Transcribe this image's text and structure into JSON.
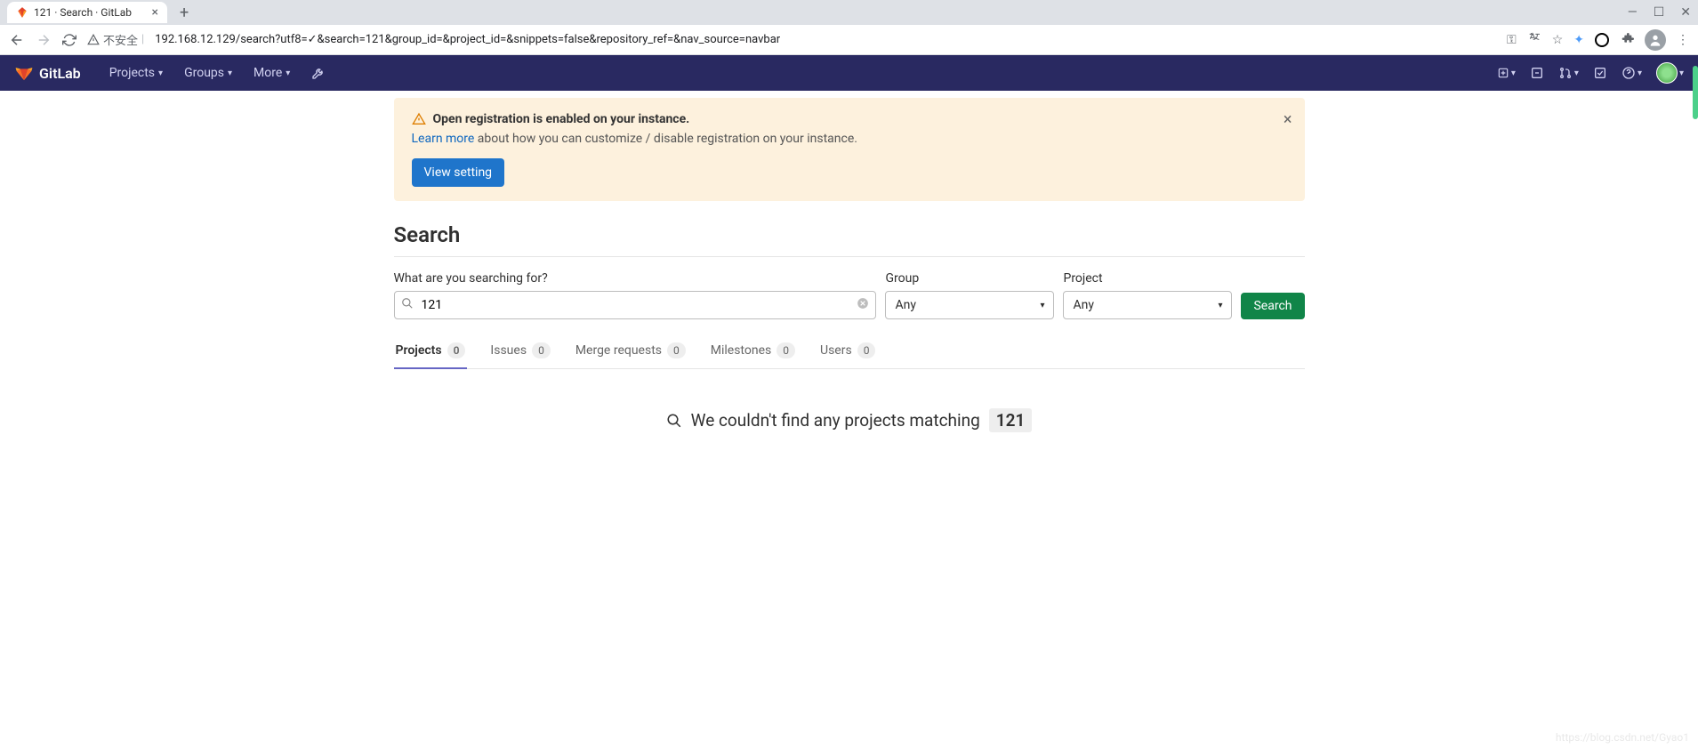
{
  "browser": {
    "tab_title": "121 · Search · GitLab",
    "security_text": "不安全",
    "url": "192.168.12.129/search?utf8=✓&search=121&group_id=&project_id=&snippets=false&repository_ref=&nav_source=navbar"
  },
  "nav": {
    "brand": "GitLab",
    "projects": "Projects",
    "groups": "Groups",
    "more": "More"
  },
  "alert": {
    "title": "Open registration is enabled on your instance.",
    "learn_more": "Learn more",
    "body": " about how you can customize / disable registration on your instance.",
    "button": "View setting"
  },
  "page": {
    "title": "Search"
  },
  "form": {
    "search_label": "What are you searching for?",
    "search_value": "121",
    "group_label": "Group",
    "group_value": "Any",
    "project_label": "Project",
    "project_value": "Any",
    "submit": "Search"
  },
  "tabs": {
    "projects": {
      "label": "Projects",
      "count": "0"
    },
    "issues": {
      "label": "Issues",
      "count": "0"
    },
    "merge_requests": {
      "label": "Merge requests",
      "count": "0"
    },
    "milestones": {
      "label": "Milestones",
      "count": "0"
    },
    "users": {
      "label": "Users",
      "count": "0"
    }
  },
  "results": {
    "message": "We couldn't find any projects matching",
    "term": "121"
  },
  "watermark": "https://blog.csdn.net/Gyao1"
}
